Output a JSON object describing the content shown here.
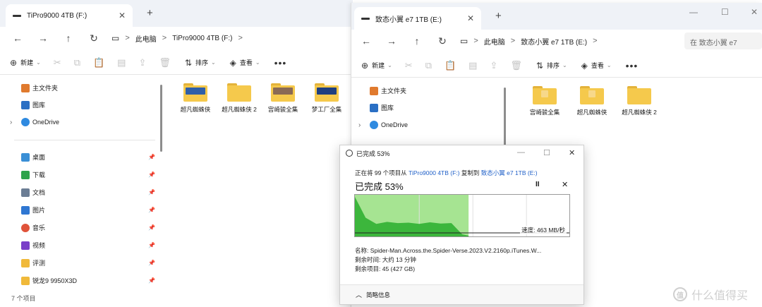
{
  "left_window": {
    "tab_title": "TiPro9000 4TB (F:)",
    "tab_close": "✕",
    "new_tab": "+",
    "nav": {
      "back": "←",
      "forward": "→",
      "up": "↑",
      "refresh": "↻",
      "monitor": "▭",
      "chevron": ">"
    },
    "breadcrumbs": [
      "此电脑",
      "TiPro9000 4TB (F:)"
    ],
    "toolbar": {
      "new": "新建",
      "sort": "排序",
      "view": "查看",
      "more": "•••"
    },
    "sidebar": {
      "pinned": [
        {
          "label": "主文件夹",
          "icon": "home-icon",
          "color": "#e07a2e"
        },
        {
          "label": "图库",
          "icon": "gallery-icon",
          "color": "#2a6fc4"
        },
        {
          "label": "OneDrive",
          "icon": "cloud-icon",
          "color": "#2f8ae0"
        }
      ],
      "quick_access": [
        {
          "label": "桌面",
          "icon": "desktop-icon",
          "color": "#3a8fd6"
        },
        {
          "label": "下载",
          "icon": "download-icon",
          "color": "#2ea34b"
        },
        {
          "label": "文档",
          "icon": "document-icon",
          "color": "#6b7d94"
        },
        {
          "label": "图片",
          "icon": "pictures-icon",
          "color": "#2f77d2"
        },
        {
          "label": "音乐",
          "icon": "music-icon",
          "color": "#e0533a"
        },
        {
          "label": "视频",
          "icon": "video-icon",
          "color": "#7a3fc8"
        },
        {
          "label": "评测",
          "icon": "folder-icon",
          "color": "#f0b93a"
        },
        {
          "label": "锐龙9 9950X3D",
          "icon": "folder-icon",
          "color": "#f0b93a"
        }
      ],
      "pin_glyph": "📌"
    },
    "folders": [
      {
        "name": "超凡蜘蛛侠",
        "thumb": "#2f5fa8"
      },
      {
        "name": "超凡蜘蛛侠 2",
        "thumb": ""
      },
      {
        "name": "宫崎骏全集",
        "thumb": "#8a6a55"
      },
      {
        "name": "梦工厂全集",
        "thumb": "#1f3f80"
      }
    ],
    "status": "7 个项目"
  },
  "right_window": {
    "tab_title": "致态小翼 e7 1TB (E:)",
    "tab_close": "✕",
    "new_tab": "+",
    "controls": {
      "minimize": "—",
      "maximize": "☐",
      "close": "✕"
    },
    "nav": {
      "back": "←",
      "forward": "→",
      "up": "↑",
      "refresh": "↻",
      "monitor": "▭",
      "chevron": ">"
    },
    "breadcrumbs": [
      "此电脑",
      "致态小翼 e7 1TB (E:)"
    ],
    "search_placeholder": "在 致态小翼 e7",
    "toolbar": {
      "new": "新建",
      "sort": "排序",
      "view": "查看",
      "more": "•••"
    },
    "sidebar": [
      {
        "label": "主文件夹",
        "icon": "home-icon",
        "color": "#e07a2e"
      },
      {
        "label": "图库",
        "icon": "gallery-icon",
        "color": "#2a6fc4"
      },
      {
        "label": "OneDrive",
        "icon": "cloud-icon",
        "color": "#2f8ae0"
      }
    ],
    "folders": [
      {
        "name": "宫崎骏全集"
      },
      {
        "name": "超凡蜘蛛侠"
      },
      {
        "name": "超凡蜘蛛侠 2"
      }
    ]
  },
  "copy_dialog": {
    "title": "已完成 53%",
    "controls": {
      "minimize": "—",
      "maximize": "☐",
      "close": "✕"
    },
    "progress_prefix": "正在将 99 个项目从",
    "source": "TiPro9000 4TB (F:)",
    "middle": "复制到",
    "destination": "致态小翼 e7 1TB (E:)",
    "percent_label": "已完成 53%",
    "percent": 53,
    "pause": "II",
    "cancel": "✕",
    "speed": "速度: 463 MB/秒",
    "name_line": "名称: Spider-Man.Across.the.Spider-Verse.2023.V2.2160p.iTunes.W...",
    "time_line": "剩余时间: 大约 13 分钟",
    "items_line": "剩余项目: 45 (427 GB)",
    "details_toggle": "简略信息",
    "chart_data": {
      "type": "area",
      "x": [
        0,
        5,
        10,
        15,
        20,
        25,
        30,
        35,
        40,
        45,
        50,
        53
      ],
      "y": [
        0.95,
        0.45,
        0.3,
        0.35,
        0.32,
        0.33,
        0.3,
        0.34,
        0.31,
        0.32,
        0.05,
        0.02
      ],
      "xlim": [
        0,
        100
      ],
      "ylim": [
        0,
        1
      ],
      "fill_color": "#3cb63c",
      "progress_color": "#a6e492"
    }
  },
  "watermark": {
    "logo": "值",
    "text": "什么值得买"
  }
}
